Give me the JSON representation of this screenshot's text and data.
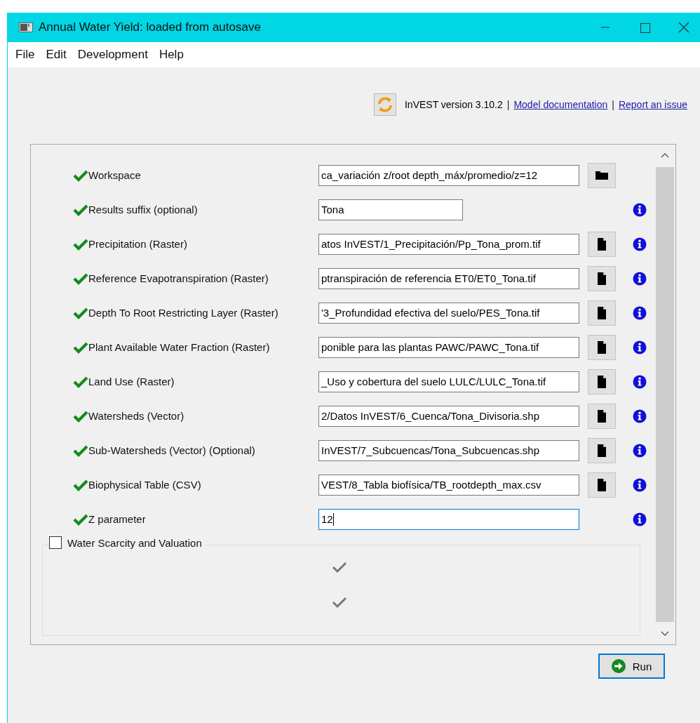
{
  "window": {
    "title": "Annual Water Yield: loaded from autosave"
  },
  "menu": [
    {
      "label": "File"
    },
    {
      "label": "Edit"
    },
    {
      "label": "Development"
    },
    {
      "label": "Help"
    }
  ],
  "header": [
    {
      "kind": "text",
      "text": "InVEST version 3.10.2"
    },
    {
      "kind": "separator",
      "text": "|"
    },
    {
      "kind": "link",
      "text": "Model documentation"
    },
    {
      "kind": "separator",
      "text": "|"
    },
    {
      "kind": "link",
      "text": "Report an issue"
    }
  ],
  "inputs": [
    {
      "label": "Workspace",
      "value": "ca_variación z/root depth_máx/promedio/z=12",
      "kind": "directory",
      "valid": true,
      "info": false,
      "focused": false
    },
    {
      "label": "Results suffix (optional)",
      "value": "Tona",
      "kind": "text",
      "valid": true,
      "info": true,
      "focused": false
    },
    {
      "label": "Precipitation (Raster)",
      "value": "atos InVEST/1_Precipitación/Pp_Tona_prom.tif",
      "kind": "file",
      "valid": true,
      "info": true,
      "focused": false
    },
    {
      "label": "Reference Evapotranspiration (Raster)",
      "value": "ptranspiración de referencia ET0/ET0_Tona.tif",
      "kind": "file",
      "valid": true,
      "info": true,
      "focused": false
    },
    {
      "label": "Depth To Root Restricting Layer (Raster)",
      "value": "'3_Profundidad efectiva del suelo/PES_Tona.tif",
      "kind": "file",
      "valid": true,
      "info": true,
      "focused": false
    },
    {
      "label": "Plant Available Water Fraction (Raster)",
      "value": "ponible para las plantas PAWC/PAWC_Tona.tif",
      "kind": "file",
      "valid": true,
      "info": true,
      "focused": false
    },
    {
      "label": "Land Use (Raster)",
      "value": "_Uso y cobertura del suelo LULC/LULC_Tona.tif",
      "kind": "file",
      "valid": true,
      "info": true,
      "focused": false
    },
    {
      "label": "Watersheds (Vector)",
      "value": "2/Datos InVEST/6_Cuenca/Tona_Divisoria.shp",
      "kind": "file",
      "valid": true,
      "info": true,
      "focused": false
    },
    {
      "label": "Sub-Watersheds (Vector) (Optional)",
      "value": "InVEST/7_Subcuencas/Tona_Subcuencas.shp",
      "kind": "file",
      "valid": true,
      "info": true,
      "focused": false
    },
    {
      "label": "Biophysical Table (CSV)",
      "value": "VEST/8_Tabla biofísica/TB_rootdepth_max.csv",
      "kind": "file",
      "valid": true,
      "info": true,
      "focused": false
    },
    {
      "label": "Z parameter",
      "value": "12",
      "kind": "number",
      "valid": true,
      "info": true,
      "focused": true
    }
  ],
  "optional_section": {
    "label": "Water Scarcity and Valuation",
    "checked": false,
    "rows": [
      {
        "valid": true
      },
      {
        "valid": true
      }
    ]
  },
  "run_button": {
    "label": "Run"
  }
}
